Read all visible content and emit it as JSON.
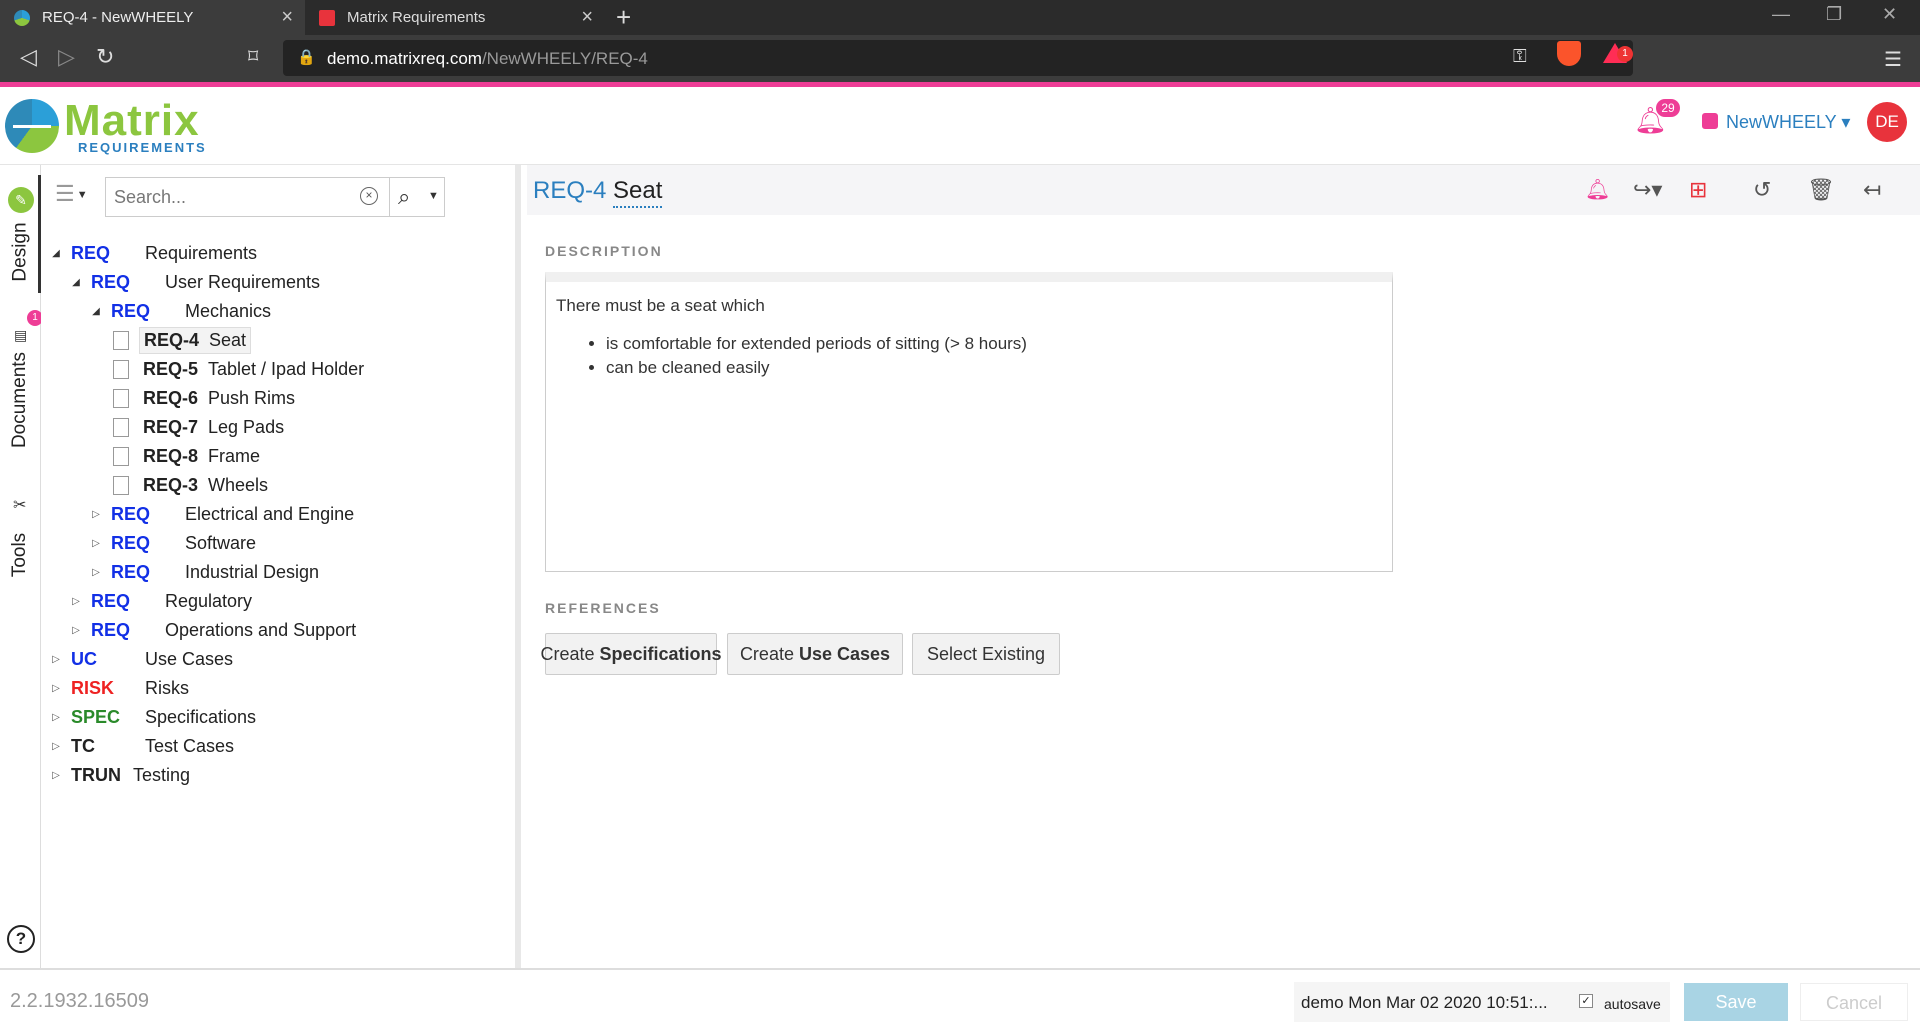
{
  "browser": {
    "tabs": [
      {
        "title": "REQ-4 - NewWHEELY",
        "active": true
      },
      {
        "title": "Matrix Requirements",
        "active": false
      }
    ],
    "url_host": "demo.matrixreq.com",
    "url_path": "/NewWHEELY/REQ-4",
    "extension_badge": "1"
  },
  "app": {
    "logo_text": "Matrix",
    "logo_sub": "REQUIREMENTS",
    "notification_count": "29",
    "project_name": "NewWHEELY ▾",
    "user_initials": "DE",
    "accent_color": "#ee3d96",
    "brand_blue": "#2b7fbf",
    "brand_green": "#8cc63f"
  },
  "side_nav": {
    "design_label": "Design",
    "documents_label": "Documents",
    "documents_badge": "1",
    "tools_label": "Tools",
    "help_label": "?"
  },
  "tree": {
    "search_placeholder": "Search...",
    "rows": [
      {
        "cat": "REQ",
        "label": "Requirements"
      },
      {
        "cat": "REQ",
        "label": "User Requirements"
      },
      {
        "cat": "REQ",
        "label": "Mechanics"
      },
      {
        "id": "REQ-4",
        "label": "Seat"
      },
      {
        "id": "REQ-5",
        "label": "Tablet / Ipad Holder"
      },
      {
        "id": "REQ-6",
        "label": "Push Rims"
      },
      {
        "id": "REQ-7",
        "label": "Leg Pads"
      },
      {
        "id": "REQ-8",
        "label": "Frame"
      },
      {
        "id": "REQ-3",
        "label": "Wheels"
      },
      {
        "cat": "REQ",
        "label": "Electrical and Engine"
      },
      {
        "cat": "REQ",
        "label": "Software"
      },
      {
        "cat": "REQ",
        "label": "Industrial Design"
      },
      {
        "cat": "REQ",
        "label": "Regulatory"
      },
      {
        "cat": "REQ",
        "label": "Operations and Support"
      },
      {
        "cat": "UC",
        "label": "Use Cases"
      },
      {
        "cat": "RISK",
        "label": "Risks"
      },
      {
        "cat": "SPEC",
        "label": "Specifications"
      },
      {
        "cat": "TC",
        "label": "Test Cases"
      },
      {
        "cat": "TRUN",
        "label": "Testing"
      }
    ]
  },
  "item": {
    "id": "REQ-4",
    "title": "Seat",
    "description_label": "DESCRIPTION",
    "description_text": "There must be a seat which",
    "description_bullets": [
      "is comfortable for extended periods of sitting (> 8 hours)",
      "can be cleaned easily"
    ],
    "references_label": "REFERENCES",
    "buttons": {
      "create_spec_prefix": "Create",
      "create_spec_bold": "Specifications",
      "create_uc_prefix": "Create",
      "create_uc_bold": "Use Cases",
      "select_existing": "Select Existing"
    }
  },
  "footer": {
    "version": "2.2.1932.16509",
    "last_saved": "demo Mon Mar 02 2020 10:51:...",
    "autosave_label": "autosave",
    "save_label": "Save",
    "cancel_label": "Cancel"
  }
}
